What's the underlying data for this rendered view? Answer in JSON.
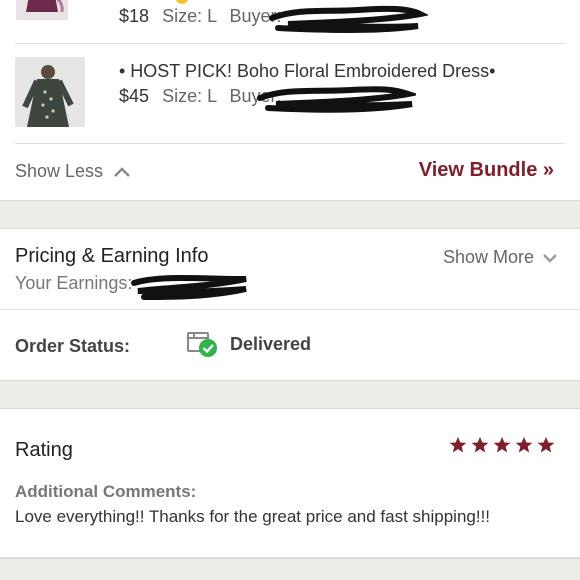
{
  "items": [
    {
      "title": "",
      "price": "$18",
      "size_text": "Size: L",
      "buyer_label": "Buyer:"
    },
    {
      "title": "• HOST PICK! Boho Floral Embroidered Dress•",
      "price": "$45",
      "size_text": "Size: L",
      "buyer_label": "Buyer:"
    }
  ],
  "bundle": {
    "show_less_label": "Show Less",
    "view_bundle_label": "View Bundle »"
  },
  "pricing": {
    "title": "Pricing & Earning Info",
    "earnings_label": "Your Earnings:",
    "show_more_label": "Show More"
  },
  "order": {
    "status_label": "Order Status:",
    "status_value": "Delivered"
  },
  "rating": {
    "title": "Rating",
    "stars": 5,
    "max_stars": 5,
    "comments_label": "Additional Comments:",
    "comment_text": "Love everything!! Thanks for the great price and fast shipping!!!"
  },
  "colors": {
    "brand": "#7f1f2c",
    "delivered_green": "#2fb34a",
    "divider_gray": "#eeece8"
  }
}
